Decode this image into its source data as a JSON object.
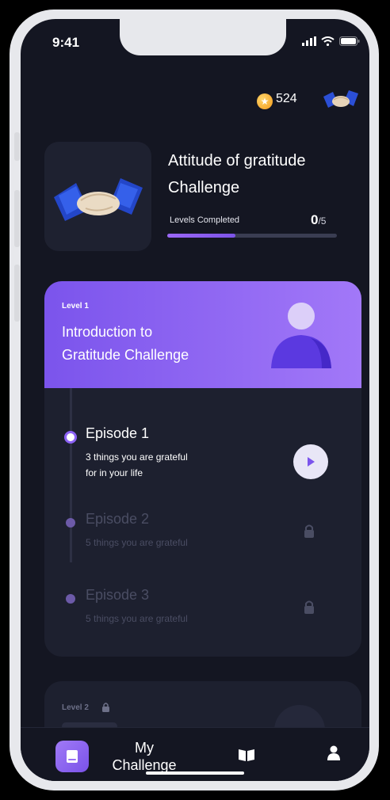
{
  "status": {
    "time": "9:41"
  },
  "header": {
    "coins": "524"
  },
  "challenge": {
    "title_line1": "Attitude of gratitude",
    "title_line2": "Challenge",
    "levels_label": "Levels Completed",
    "levels_done": "0",
    "levels_total": "/5",
    "progress_fraction": 0.4
  },
  "level1": {
    "tag": "Level 1",
    "title_line1": "Introduction to",
    "title_line2": "Gratitude Challenge",
    "episodes": [
      {
        "title": "Episode 1",
        "sub_line1": "3 things you are grateful",
        "sub_line2": "for in your life",
        "state": "active"
      },
      {
        "title": "Episode 2",
        "sub_line1": "5 things you are grateful",
        "sub_line2": "",
        "state": "locked"
      },
      {
        "title": "Episode 3",
        "sub_line1": "5 things you are grateful",
        "sub_line2": "",
        "state": "locked"
      }
    ]
  },
  "level2": {
    "tag": "Level 2"
  },
  "tabs": {
    "active_line1": "My",
    "active_line2": "Challenge"
  },
  "colors": {
    "accent": "#7b54ec",
    "accent_light": "#a278f8",
    "background": "#141622",
    "card": "#1d202f"
  }
}
